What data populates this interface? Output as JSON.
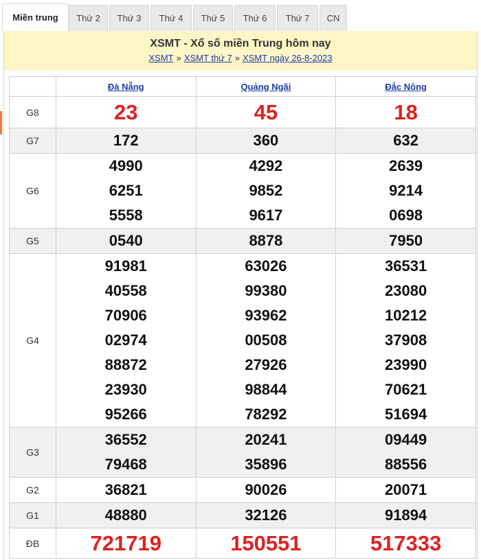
{
  "tabs": [
    {
      "label": "Miền trung",
      "active": true
    },
    {
      "label": "Thứ 2"
    },
    {
      "label": "Thứ 3"
    },
    {
      "label": "Thứ 4"
    },
    {
      "label": "Thứ 5"
    },
    {
      "label": "Thứ 6"
    },
    {
      "label": "Thứ 7"
    },
    {
      "label": "CN"
    }
  ],
  "header": {
    "title": "XSMT - Xổ số miền Trung hôm nay",
    "breadcrumb": [
      "XSMT",
      "XSMT thứ 7",
      "XSMT ngày 26-8-2023"
    ],
    "separator": "»"
  },
  "provinces": [
    "Đà Nẵng",
    "Quảng Ngãi",
    "Đắc Nông"
  ],
  "prizes": {
    "G8": {
      "label": "G8",
      "values": [
        [
          "23"
        ],
        [
          "45"
        ],
        [
          "18"
        ]
      ]
    },
    "G7": {
      "label": "G7",
      "values": [
        [
          "172"
        ],
        [
          "360"
        ],
        [
          "632"
        ]
      ]
    },
    "G6": {
      "label": "G6",
      "values": [
        [
          "4990",
          "6251",
          "5558"
        ],
        [
          "4292",
          "9852",
          "9617"
        ],
        [
          "2639",
          "9214",
          "0698"
        ]
      ]
    },
    "G5": {
      "label": "G5",
      "values": [
        [
          "0540"
        ],
        [
          "8878"
        ],
        [
          "7950"
        ]
      ]
    },
    "G4": {
      "label": "G4",
      "values": [
        [
          "91981",
          "40558",
          "70906",
          "02974",
          "88872",
          "23930",
          "95266"
        ],
        [
          "63026",
          "99380",
          "93962",
          "00508",
          "27926",
          "98844",
          "78292"
        ],
        [
          "36531",
          "23080",
          "10212",
          "37908",
          "23990",
          "70621",
          "51694"
        ]
      ]
    },
    "G3": {
      "label": "G3",
      "values": [
        [
          "36552",
          "79468"
        ],
        [
          "20241",
          "35896"
        ],
        [
          "09449",
          "88556"
        ]
      ]
    },
    "G2": {
      "label": "G2",
      "values": [
        [
          "36821"
        ],
        [
          "90026"
        ],
        [
          "20071"
        ]
      ]
    },
    "G1": {
      "label": "G1",
      "values": [
        [
          "48880"
        ],
        [
          "32126"
        ],
        [
          "91894"
        ]
      ]
    },
    "DB": {
      "label": "ĐB",
      "values": [
        [
          "721719"
        ],
        [
          "150551"
        ],
        [
          "517333"
        ]
      ]
    }
  },
  "colors": {
    "accent_red": "#e02020",
    "link_blue": "#1a3aa8",
    "header_bg": "#fff6c8"
  }
}
